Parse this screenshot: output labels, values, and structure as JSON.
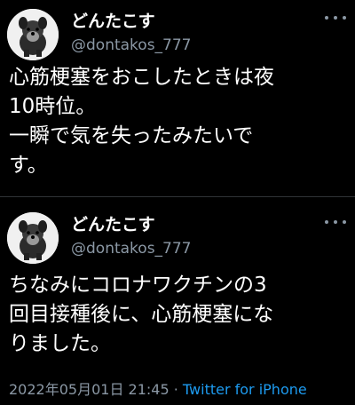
{
  "tweets": [
    {
      "display_name": "どんたこす",
      "handle": "@dontakos_777",
      "text": "心筋梗塞をおこしたときは夜\n10時位。\n一瞬で気を失ったみたいで\nす。"
    },
    {
      "display_name": "どんたこす",
      "handle": "@dontakos_777",
      "text": "ちなみにコロナワクチンの3\n回目接種後に、心筋梗塞にな\nりました。"
    }
  ],
  "meta": {
    "timestamp": "2022年05月01日 21:45",
    "separator": " · ",
    "source": "Twitter for iPhone"
  },
  "colors": {
    "background": "#000000",
    "text": "#ffffff",
    "secondary": "#8b98a5",
    "link": "#1d9bf0"
  },
  "icons": [
    "avatar-dog",
    "more-icon"
  ]
}
